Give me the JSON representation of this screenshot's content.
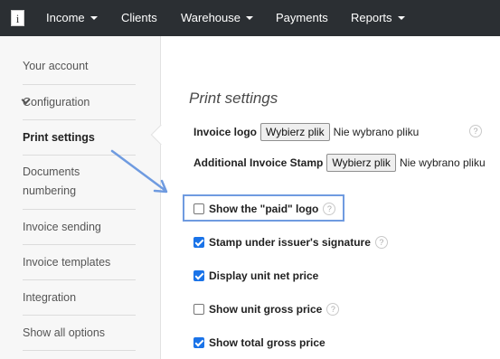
{
  "nav": {
    "logo": "i",
    "items": [
      {
        "label": "Income",
        "dropdown": true
      },
      {
        "label": "Clients",
        "dropdown": false
      },
      {
        "label": "Warehouse",
        "dropdown": true
      },
      {
        "label": "Payments",
        "dropdown": false
      },
      {
        "label": "Reports",
        "dropdown": true
      }
    ]
  },
  "sidebar": {
    "items": [
      {
        "label": "Your account"
      },
      {
        "label": "Configuration"
      },
      {
        "label": "Print settings",
        "active": true
      },
      {
        "label": "Documents",
        "label2": "numbering"
      },
      {
        "label": "Invoice sending"
      },
      {
        "label": "Invoice templates"
      },
      {
        "label": "Integration"
      },
      {
        "label": "Show all options"
      }
    ]
  },
  "main": {
    "title": "Print settings",
    "invoice_logo": {
      "label": "Invoice logo",
      "button": "Wybierz plik",
      "status": "Nie wybrano pliku"
    },
    "additional_stamp": {
      "label": "Additional Invoice Stamp",
      "button": "Wybierz plik",
      "status": "Nie wybrano pliku"
    },
    "options": [
      {
        "label": "Show the \"paid\" logo",
        "checked": false,
        "help": true,
        "highlighted": true
      },
      {
        "label": "Stamp under issuer's signature",
        "checked": true,
        "help": true
      },
      {
        "label": "Display unit net price",
        "checked": true,
        "help": false
      },
      {
        "label": "Show unit gross price",
        "checked": false,
        "help": true
      },
      {
        "label": "Show total gross price",
        "checked": true,
        "help": false
      }
    ],
    "help_glyph": "?"
  },
  "colors": {
    "navbar": "#2b2f33",
    "sidebar": "#f7f7f7",
    "checkbox_checked": "#1a73e8",
    "annotation": "#6f9be0"
  }
}
